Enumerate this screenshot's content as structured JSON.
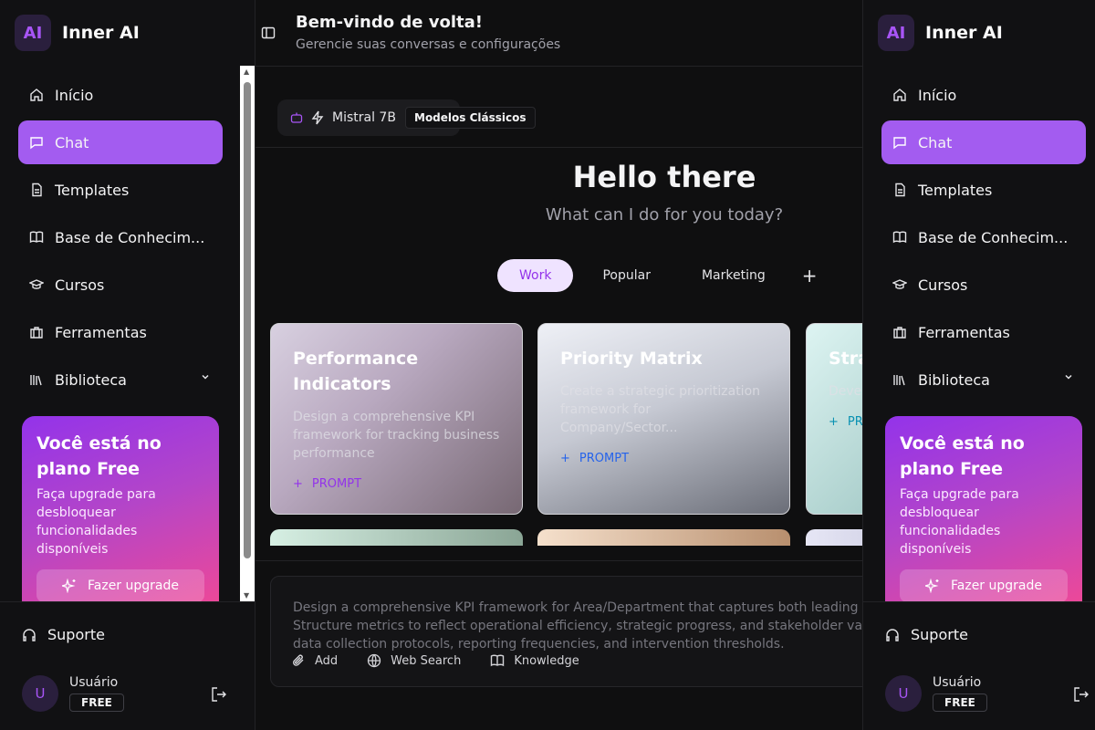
{
  "brand": {
    "logo": "AI",
    "name": "Inner AI"
  },
  "nav": [
    {
      "label": "Início",
      "icon": "home-icon",
      "active": false
    },
    {
      "label": "Chat",
      "icon": "message-icon",
      "active": true
    },
    {
      "label": "Templates",
      "icon": "document-icon",
      "active": false
    },
    {
      "label": "Base de Conhecim...",
      "icon": "book-icon",
      "active": false
    },
    {
      "label": "Cursos",
      "icon": "graduation-cap-icon",
      "active": false
    },
    {
      "label": "Ferramentas",
      "icon": "toolbox-icon",
      "active": false
    },
    {
      "label": "Biblioteca",
      "icon": "library-icon",
      "active": false
    }
  ],
  "promo": {
    "title": "Você está no plano Free",
    "text": "Faça upgrade para desbloquear funcionalidades disponíveis",
    "button": "Fazer upgrade"
  },
  "support": {
    "label": "Suporte"
  },
  "user": {
    "avatar": "U",
    "name": "Usuário",
    "plan": "FREE"
  },
  "header": {
    "title": "Bem-vindo de volta!",
    "subtitle": "Gerencie suas conversas e configurações"
  },
  "model": {
    "name": "Mistral 7B",
    "tag": "Modelos Clássicos"
  },
  "greeting": {
    "title": "Hello there",
    "subtitle": "What can I do for you today?"
  },
  "tabs": [
    {
      "label": "Work",
      "active": true
    },
    {
      "label": "Popular",
      "active": false
    },
    {
      "label": "Marketing",
      "active": false
    }
  ],
  "cards": [
    {
      "title": "Performance Indicators",
      "desc": "Design a comprehensive KPI framework for tracking business performance",
      "prompt": "PROMPT"
    },
    {
      "title": "Priority Matrix",
      "desc": "Create a strategic prioritization framework for Company/Sector...",
      "prompt": "PROMPT"
    },
    {
      "title": "Stra",
      "desc": "Deve roadm",
      "prompt": "PR"
    }
  ],
  "composer": {
    "lines": [
      "Design a comprehensive KPI framework for Area/Department that captures both leading",
      "Structure metrics to reflect operational efficiency, strategic progress, and stakeholder va",
      "data collection protocols, reporting frequencies, and intervention thresholds."
    ],
    "actions": {
      "add": "Add",
      "web_search": "Web Search",
      "knowledge": "Knowledge"
    }
  },
  "colors": {
    "accent": "#a35cf0",
    "background": "#0f0f10",
    "sidebar": "#111113"
  }
}
